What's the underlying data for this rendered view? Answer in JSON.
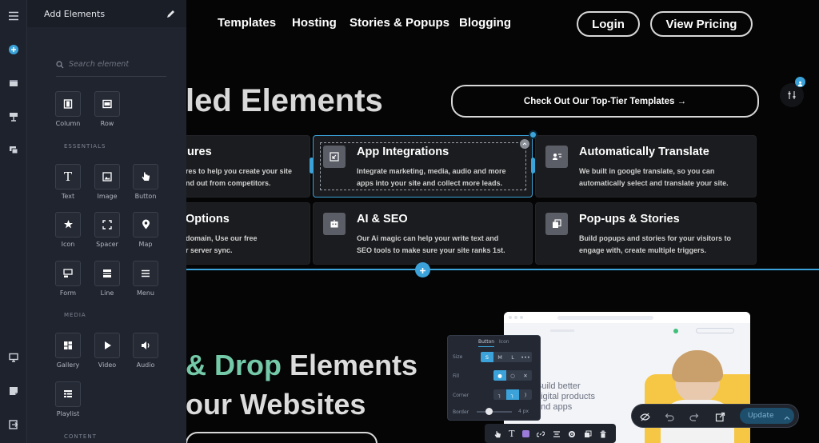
{
  "panel": {
    "title": "Add Elements",
    "search_placeholder": "Search element",
    "layout": [
      {
        "label": "Column",
        "icon": "column-icon"
      },
      {
        "label": "Row",
        "icon": "row-icon"
      }
    ],
    "sections": {
      "essentials": "ESSENTIALS",
      "media": "MEDIA",
      "content": "CONTENT"
    },
    "essentials": [
      {
        "label": "Text",
        "icon": "text-icon"
      },
      {
        "label": "Image",
        "icon": "image-icon"
      },
      {
        "label": "Button",
        "icon": "pointer-hand-icon"
      },
      {
        "label": "Icon",
        "icon": "star-icon"
      },
      {
        "label": "Spacer",
        "icon": "spacer-icon"
      },
      {
        "label": "Map",
        "icon": "map-pin-icon"
      },
      {
        "label": "Form",
        "icon": "form-icon"
      },
      {
        "label": "Line",
        "icon": "line-icon"
      },
      {
        "label": "Menu",
        "icon": "menu-icon"
      }
    ],
    "media": [
      {
        "label": "Gallery",
        "icon": "gallery-icon"
      },
      {
        "label": "Video",
        "icon": "play-icon"
      },
      {
        "label": "Audio",
        "icon": "speaker-icon"
      },
      {
        "label": "Playlist",
        "icon": "playlist-icon"
      }
    ]
  },
  "nav": {
    "links": [
      "Templates",
      "Hosting",
      "Stories & Popups",
      "Blogging"
    ],
    "login": "Login",
    "view_pricing": "View Pricing"
  },
  "hero": {
    "heading_visible": "led Elements",
    "cta": "Check Out Our Top-Tier Templates →"
  },
  "cards": [
    {
      "title": "ures",
      "desc1": "res to help you create your site",
      "desc2": "nd out from competitors."
    },
    {
      "title": "App Integrations",
      "desc1": "Integrate marketing, media, audio and more",
      "desc2": "apps into your site and collect more leads."
    },
    {
      "title": "Automatically Translate",
      "desc1": "We built in google translate, so you can",
      "desc2": "automatically select and translate your site."
    },
    {
      "title": "Options",
      "desc1": "domain, Use our free",
      "desc2": "r server sync."
    },
    {
      "title": "AI & SEO",
      "desc1": "Our Ai magic can help your write text and",
      "desc2": "SEO tools to make sure your site ranks 1st."
    },
    {
      "title": "Pop-ups & Stories",
      "desc1": "Build popups and stories for your visitors to",
      "desc2": "engage with, create multiple triggers."
    }
  ],
  "bottom": {
    "line1_a": "& Drop",
    "line1_b": " Elements",
    "line2": "our Websites"
  },
  "mock": {
    "text1": "Build better",
    "text2": "digital products",
    "text3": "and apps"
  },
  "button_panel": {
    "tab_button": "Button",
    "tab_icon": "Icon",
    "size_label": "Size",
    "sizes": [
      "S",
      "M",
      "L",
      "•••"
    ],
    "fill_label": "Fill",
    "corner_label": "Corner",
    "border_label": "Border",
    "border_value": "4 px"
  },
  "action_bar": {
    "update": "Update"
  },
  "colors": {
    "accent_blue": "#3ba3d9",
    "drop_gradient_start": "#5bbf9a",
    "drop_gradient_end": "#7fd1b9",
    "mock_yellow": "#f6c744"
  }
}
